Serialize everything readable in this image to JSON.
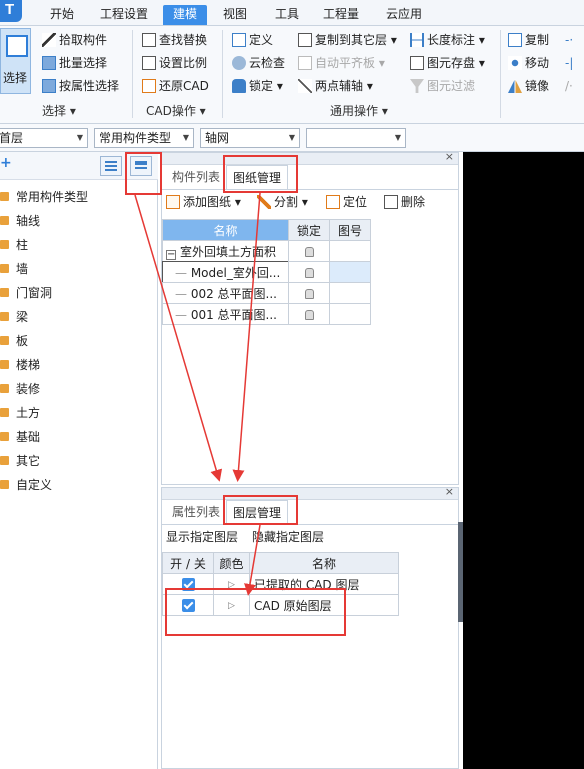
{
  "menu": {
    "tabs": [
      "开始",
      "工程设置",
      "建模",
      "视图",
      "工具",
      "工程量",
      "云应用"
    ],
    "active_tab": "建模"
  },
  "ribbon": {
    "select_group": {
      "big_button": "选择",
      "items": [
        "拾取构件",
        "批量选择",
        "按属性选择"
      ],
      "label": "选择"
    },
    "cad_group": {
      "items": [
        "查找替换",
        "设置比例",
        "还原CAD"
      ],
      "label": "CAD操作"
    },
    "common_group": {
      "col1": [
        "定义",
        "云检查",
        "锁定"
      ],
      "col2": [
        "复制到其它层",
        "自动平齐板",
        "两点辅轴"
      ],
      "col3": [
        "长度标注",
        "图元存盘",
        "图元过滤"
      ],
      "label": "通用操作"
    },
    "edit_group": {
      "items": [
        "复制",
        "移动",
        "镜像"
      ]
    }
  },
  "dropdowns": [
    "首层",
    "常用构件类型",
    "轴网",
    ""
  ],
  "tree": {
    "items": [
      "常用构件类型",
      "轴线",
      "柱",
      "墙",
      "门窗洞",
      "梁",
      "板",
      "楼梯",
      "装修",
      "土方",
      "基础",
      "其它",
      "自定义"
    ]
  },
  "drawing_panel": {
    "tabs": [
      "构件列表",
      "图纸管理"
    ],
    "toolbar": [
      "添加图纸",
      "分割",
      "定位",
      "删除"
    ],
    "columns": [
      "名称",
      "锁定",
      "图号"
    ],
    "rows": [
      {
        "name": "室外回填土方面积",
        "prefix": "−"
      },
      {
        "name": "Model_室外回...",
        "prefix": ""
      },
      {
        "name": "002 总平面图...",
        "prefix": ""
      },
      {
        "name": "001 总平面图...",
        "prefix": ""
      }
    ]
  },
  "layer_panel": {
    "tabs": [
      "属性列表",
      "图层管理"
    ],
    "toolbar": [
      "显示指定图层",
      "隐藏指定图层"
    ],
    "columns": [
      "开 / 关",
      "颜色",
      "名称"
    ],
    "rows": [
      {
        "name": "已提取的 CAD 图层",
        "on": true
      },
      {
        "name": "CAD 原始图层",
        "on": true
      }
    ]
  },
  "colors": {
    "accent": "#3b8ee8",
    "annotation": "#e53935",
    "canvas": "#000000"
  }
}
